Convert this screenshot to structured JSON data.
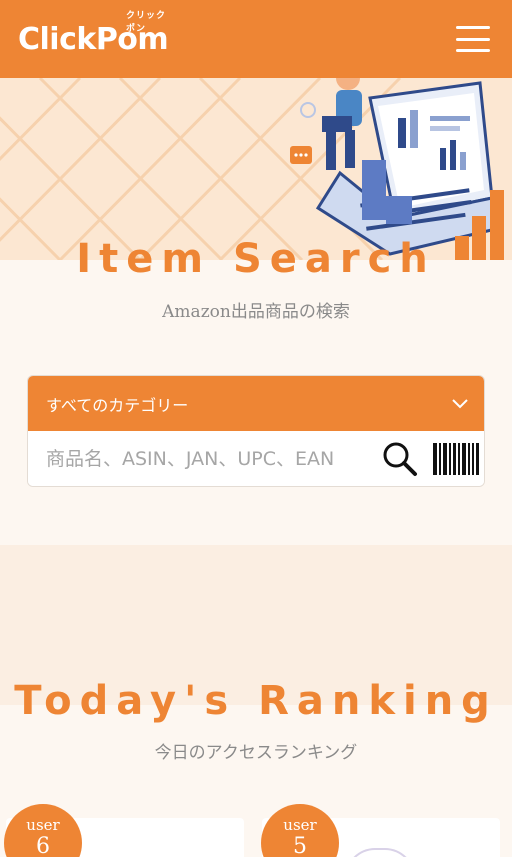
{
  "header": {
    "logo_text": "ClickPom",
    "logo_kana": "クリックポン",
    "menu_icon": "hamburger-menu-icon",
    "brand_color": "#ee8534"
  },
  "hero": {
    "title": "Item Search",
    "subtitle": "Amazon出品商品の検索",
    "illustration": "person-with-laptop-illustration"
  },
  "search": {
    "category_selected": "すべてのカテゴリー",
    "placeholder": "商品名、ASIN、JAN、UPC、EAN",
    "search_icon": "magnifier-icon",
    "barcode_icon": "barcode-icon"
  },
  "ranking": {
    "title": "Today's Ranking",
    "subtitle": "今日のアクセスランキング",
    "cards": [
      {
        "label": "user",
        "number": "6"
      },
      {
        "label": "user",
        "number": "5"
      }
    ]
  }
}
